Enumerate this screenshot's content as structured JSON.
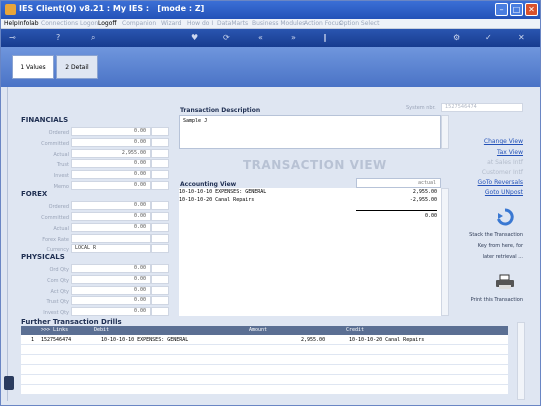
{
  "window": {
    "title": "IES Client(Q) v8.21 : My IES :",
    "mode": "[mode : Z]"
  },
  "menu": [
    "Help",
    "Infolab",
    "Connections",
    "Logon",
    "Logoff",
    "Companion",
    "Wizard",
    "How do I",
    "DataMarts",
    "Business Modules",
    "Action Focus",
    "Option Select"
  ],
  "tabs": [
    {
      "label": "1 Values"
    },
    {
      "label": "2 Detail"
    }
  ],
  "financials": {
    "heading": "FINANCIALS",
    "rows": [
      {
        "label": "Ordered",
        "value": "0.00"
      },
      {
        "label": "Committed",
        "value": "0.00"
      },
      {
        "label": "Actual",
        "value": "2,955.00"
      },
      {
        "label": "Trust",
        "value": "0.00"
      },
      {
        "label": "Invest",
        "value": "0.00"
      },
      {
        "label": "Memo",
        "value": "0.00"
      }
    ]
  },
  "forex": {
    "heading": "FOREX",
    "rows": [
      {
        "label": "Ordered",
        "value": "0.00"
      },
      {
        "label": "Committed",
        "value": "0.00"
      },
      {
        "label": "Actual",
        "value": "0.00"
      },
      {
        "label": "Forex Rate",
        "value": ""
      },
      {
        "label": "Currency",
        "value": "LOCAL R"
      }
    ]
  },
  "physicals": {
    "heading": "PHYSICALS",
    "rows": [
      {
        "label": "Ord Qty",
        "value": "0.00"
      },
      {
        "label": "Com Qty",
        "value": "0.00"
      },
      {
        "label": "Act Qty",
        "value": "0.00"
      },
      {
        "label": "Trust Qty",
        "value": "0.00"
      },
      {
        "label": "Invest Qty",
        "value": "0.00"
      }
    ]
  },
  "transaction": {
    "desc_heading": "Transaction Description",
    "description": "Sample J",
    "system_label": "System nbr.",
    "system_value": "1527546474",
    "watermark": "TRANSACTION VIEW"
  },
  "accounting": {
    "heading": "Accounting View",
    "actual_label": "actual",
    "lines": [
      {
        "account": "10-10-10-10 EXPENSES: GENERAL",
        "amount": "2,955.00"
      },
      {
        "account": "10-10-10-20 Canal Repairs",
        "amount": "-2,955.00"
      }
    ],
    "total": "0.00"
  },
  "actions": {
    "change_view": "Change View",
    "tax_view": "Tax View",
    "dis1": "at Sales Intf",
    "dis2": "Customer Intf",
    "goto_reversals": "GoTo Reversals",
    "goto_unpost": "Goto UNpost",
    "stack_line1": "Stack the Transaction",
    "stack_line2": "Key from here, for",
    "stack_line3": "later retrieval ...",
    "print": "Print this Transaction"
  },
  "drills": {
    "heading": "Further Transaction Drills",
    "columns": {
      "links": ">>> Links",
      "debit": "Debit",
      "amount": "Amount",
      "credit": "Credit"
    },
    "rows": [
      {
        "idx": "1",
        "link": "1527546474",
        "debit": "10-10-10-10 EXPENSES: GENERAL",
        "amount": "2,955.00",
        "credit": "10-10-10-20 Canal Repairs"
      }
    ]
  },
  "colors": {
    "accent": "#2452b8",
    "title": "#2352b8",
    "panel": "#dfe6f2"
  }
}
